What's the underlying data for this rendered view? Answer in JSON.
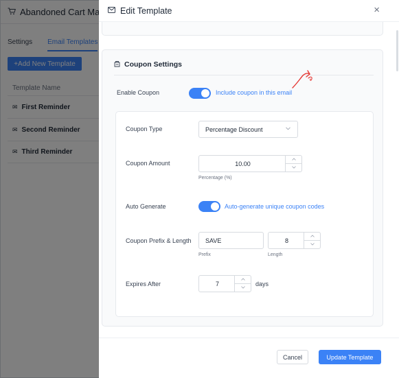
{
  "background": {
    "app_title": "Abandoned Cart Manag",
    "tabs": [
      {
        "label": "Settings",
        "active": false
      },
      {
        "label": "Email Templates",
        "active": true
      }
    ],
    "add_button_label": "+Add New Template",
    "column_header": "Template Name",
    "rows": [
      "First Reminder",
      "Second Reminder",
      "Third Reminder"
    ]
  },
  "drawer": {
    "title": "Edit Template",
    "close_glyph": "×",
    "section_title": "Coupon Settings",
    "enable_coupon": {
      "label": "Enable Coupon",
      "on": true,
      "text": "Include coupon in this email"
    },
    "coupon_type": {
      "label": "Coupon Type",
      "value": "Percentage Discount"
    },
    "coupon_amount": {
      "label": "Coupon Amount",
      "value": "10.00",
      "hint": "Percentage (%)"
    },
    "auto_generate": {
      "label": "Auto Generate",
      "on": true,
      "text": "Auto-generate unique coupon codes"
    },
    "prefix_length": {
      "label": "Coupon Prefix & Length",
      "prefix_value": "SAVE",
      "prefix_hint": "Prefix",
      "length_value": "8",
      "length_hint": "Length"
    },
    "expires": {
      "label": "Expires After",
      "value": "7",
      "unit": "days"
    },
    "cancel_label": "Cancel",
    "update_label": "Update Template"
  },
  "colors": {
    "accent": "#3b82f6",
    "overlay": "rgba(0,0,0,0.5)",
    "annotation": "#e53935"
  },
  "icons": [
    "cart-icon",
    "envelope-icon",
    "close-icon",
    "tag-icon",
    "chevron-down-icon",
    "chevron-up-icon",
    "arrow-annotation-icon"
  ]
}
